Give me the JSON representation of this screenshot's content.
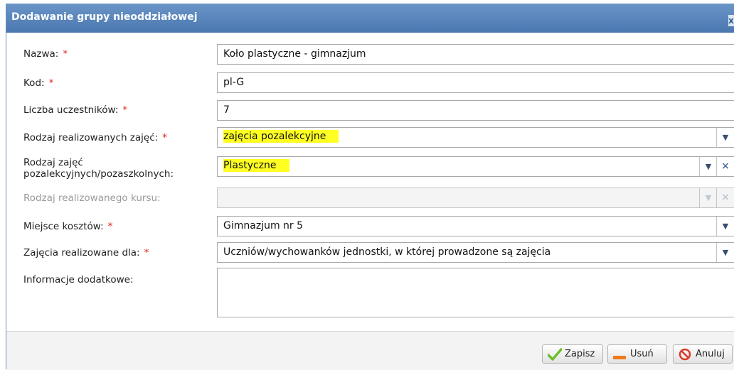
{
  "dialog": {
    "title": "Dodawanie grupy nieoddziałowej",
    "close_label": "x"
  },
  "fields": {
    "nazwa": {
      "label": "Nazwa:",
      "required": "*",
      "value": "Koło plastyczne - gimnazjum"
    },
    "kod": {
      "label": "Kod:",
      "required": "*",
      "value": "pl-G"
    },
    "liczba": {
      "label": "Liczba uczestników:",
      "required": "*",
      "value": "7"
    },
    "rodzaj_zajec": {
      "label": "Rodzaj realizowanych zajęć:",
      "required": "*",
      "value": "zajęcia pozalekcyjne"
    },
    "rodzaj_pozalekcyjnych": {
      "label_line1": "Rodzaj zajęć",
      "label_line2": "pozalekcyjnych/pozaszkolnych:",
      "value": "Plastyczne"
    },
    "rodzaj_kursu": {
      "label": "Rodzaj realizowanego kursu:",
      "value": ""
    },
    "miejsce_kosztow": {
      "label": "Miejsce kosztów:",
      "required": "*",
      "value": "Gimnazjum nr 5"
    },
    "zajecia_dla": {
      "label": "Zajęcia realizowane dla:",
      "required": "*",
      "value": "Uczniów/wychowanków jednostki, w której prowadzone są  zajęcia"
    },
    "informacje": {
      "label": "Informacje dodatkowe:",
      "value": ""
    }
  },
  "buttons": {
    "save": "Zapisz",
    "delete": "Usuń",
    "cancel": "Anuluj"
  },
  "colors": {
    "titlebar": "#4a77b0",
    "required": "#e0241b",
    "highlight": "#ffff22",
    "save_icon": "#6cbf2b",
    "delete_icon": "#f07a1a",
    "cancel_icon": "#d93a2b"
  }
}
